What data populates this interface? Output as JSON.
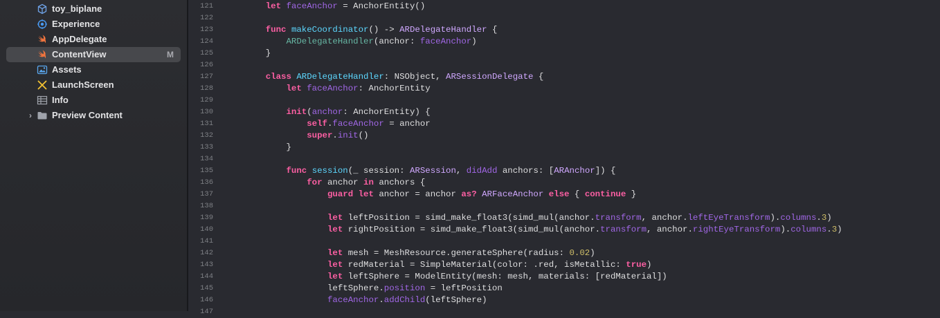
{
  "sidebar": {
    "items": [
      {
        "label": "toy_biplane",
        "icon": "cube-icon",
        "badge": ""
      },
      {
        "label": "Experience",
        "icon": "reality-composer-icon",
        "badge": ""
      },
      {
        "label": "AppDelegate",
        "icon": "swift-icon",
        "badge": ""
      },
      {
        "label": "ContentView",
        "icon": "swift-icon",
        "badge": "M",
        "selected": true
      },
      {
        "label": "Assets",
        "icon": "asset-catalog-icon",
        "badge": ""
      },
      {
        "label": "LaunchScreen",
        "icon": "storyboard-icon",
        "badge": ""
      },
      {
        "label": "Info",
        "icon": "plist-table-icon",
        "badge": ""
      },
      {
        "label": "Preview Content",
        "icon": "folder-icon",
        "badge": "",
        "chevron": "›"
      }
    ]
  },
  "editor": {
    "lines": [
      {
        "n": "121",
        "t": [
          [
            "    ",
            "pl"
          ],
          [
            "let",
            "kw"
          ],
          [
            " ",
            "pl"
          ],
          [
            "faceAnchor",
            "pr"
          ],
          [
            " = ",
            "pl"
          ],
          [
            "AnchorEntity",
            "pl"
          ],
          [
            "()",
            "pl"
          ]
        ]
      },
      {
        "n": "122",
        "t": []
      },
      {
        "n": "123",
        "t": [
          [
            "    ",
            "pl"
          ],
          [
            "func",
            "kw"
          ],
          [
            " ",
            "pl"
          ],
          [
            "makeCoordinator",
            "id"
          ],
          [
            "() -> ",
            "pl"
          ],
          [
            "ARDelegateHandler",
            "ty"
          ],
          [
            " {",
            "pl"
          ]
        ]
      },
      {
        "n": "124",
        "t": [
          [
            "        ",
            "pl"
          ],
          [
            "ARDelegateHandler",
            "fn"
          ],
          [
            "(anchor: ",
            "pl"
          ],
          [
            "faceAnchor",
            "pr"
          ],
          [
            ")",
            "pl"
          ]
        ]
      },
      {
        "n": "125",
        "t": [
          [
            "    }",
            "pl"
          ]
        ]
      },
      {
        "n": "126",
        "t": []
      },
      {
        "n": "127",
        "t": [
          [
            "    ",
            "pl"
          ],
          [
            "class",
            "kw"
          ],
          [
            " ",
            "pl"
          ],
          [
            "ARDelegateHandler",
            "id"
          ],
          [
            ": ",
            "pl"
          ],
          [
            "NSObject",
            "pl"
          ],
          [
            ", ",
            "pl"
          ],
          [
            "ARSessionDelegate",
            "ty"
          ],
          [
            " {",
            "pl"
          ]
        ]
      },
      {
        "n": "128",
        "t": [
          [
            "        ",
            "pl"
          ],
          [
            "let",
            "kw"
          ],
          [
            " ",
            "pl"
          ],
          [
            "faceAnchor",
            "pr"
          ],
          [
            ": ",
            "pl"
          ],
          [
            "AnchorEntity",
            "pl"
          ]
        ]
      },
      {
        "n": "129",
        "t": []
      },
      {
        "n": "130",
        "t": [
          [
            "        ",
            "pl"
          ],
          [
            "init",
            "kw"
          ],
          [
            "(",
            "pl"
          ],
          [
            "anchor",
            "pr"
          ],
          [
            ": ",
            "pl"
          ],
          [
            "AnchorEntity",
            "pl"
          ],
          [
            ") {",
            "pl"
          ]
        ]
      },
      {
        "n": "131",
        "t": [
          [
            "            ",
            "pl"
          ],
          [
            "self",
            "kw"
          ],
          [
            ".",
            "pl"
          ],
          [
            "faceAnchor",
            "pr"
          ],
          [
            " = anchor",
            "pl"
          ]
        ]
      },
      {
        "n": "132",
        "t": [
          [
            "            ",
            "pl"
          ],
          [
            "super",
            "kw"
          ],
          [
            ".",
            "pl"
          ],
          [
            "init",
            "pr"
          ],
          [
            "()",
            "pl"
          ]
        ]
      },
      {
        "n": "133",
        "t": [
          [
            "        }",
            "pl"
          ]
        ]
      },
      {
        "n": "134",
        "t": []
      },
      {
        "n": "135",
        "t": [
          [
            "        ",
            "pl"
          ],
          [
            "func",
            "kw"
          ],
          [
            " ",
            "pl"
          ],
          [
            "session",
            "id"
          ],
          [
            "(_ session: ",
            "pl"
          ],
          [
            "ARSession",
            "ty"
          ],
          [
            ", ",
            "pl"
          ],
          [
            "didAdd",
            "pr"
          ],
          [
            " anchors: [",
            "pl"
          ],
          [
            "ARAnchor",
            "ty"
          ],
          [
            "]) {",
            "pl"
          ]
        ]
      },
      {
        "n": "136",
        "t": [
          [
            "            ",
            "pl"
          ],
          [
            "for",
            "kw"
          ],
          [
            " anchor ",
            "pl"
          ],
          [
            "in",
            "kw"
          ],
          [
            " anchors {",
            "pl"
          ]
        ]
      },
      {
        "n": "137",
        "t": [
          [
            "                ",
            "pl"
          ],
          [
            "guard",
            "kw"
          ],
          [
            " ",
            "pl"
          ],
          [
            "let",
            "kw"
          ],
          [
            " anchor = anchor ",
            "pl"
          ],
          [
            "as?",
            "kw"
          ],
          [
            " ",
            "pl"
          ],
          [
            "ARFaceAnchor",
            "ty"
          ],
          [
            " ",
            "pl"
          ],
          [
            "else",
            "kw"
          ],
          [
            " { ",
            "pl"
          ],
          [
            "continue",
            "kw"
          ],
          [
            " }",
            "pl"
          ]
        ]
      },
      {
        "n": "138",
        "t": []
      },
      {
        "n": "139",
        "t": [
          [
            "                ",
            "pl"
          ],
          [
            "let",
            "kw"
          ],
          [
            " leftPosition = simd_make_float3(simd_mul(anchor.",
            "pl"
          ],
          [
            "transform",
            "pr"
          ],
          [
            ", anchor.",
            "pl"
          ],
          [
            "leftEyeTransform",
            "pr"
          ],
          [
            ").",
            "pl"
          ],
          [
            "columns",
            "pr"
          ],
          [
            ".",
            "pl"
          ],
          [
            "3",
            "num"
          ],
          [
            ")",
            "pl"
          ]
        ]
      },
      {
        "n": "140",
        "t": [
          [
            "                ",
            "pl"
          ],
          [
            "let",
            "kw"
          ],
          [
            " rightPosition = simd_make_float3(simd_mul(anchor.",
            "pl"
          ],
          [
            "transform",
            "pr"
          ],
          [
            ", anchor.",
            "pl"
          ],
          [
            "rightEyeTransform",
            "pr"
          ],
          [
            ").",
            "pl"
          ],
          [
            "columns",
            "pr"
          ],
          [
            ".",
            "pl"
          ],
          [
            "3",
            "num"
          ],
          [
            ")",
            "pl"
          ]
        ]
      },
      {
        "n": "141",
        "t": []
      },
      {
        "n": "142",
        "t": [
          [
            "                ",
            "pl"
          ],
          [
            "let",
            "kw"
          ],
          [
            " mesh = MeshResource.generateSphere(radius: ",
            "pl"
          ],
          [
            "0.02",
            "num"
          ],
          [
            ")",
            "pl"
          ]
        ]
      },
      {
        "n": "143",
        "t": [
          [
            "                ",
            "pl"
          ],
          [
            "let",
            "kw"
          ],
          [
            " redMaterial = SimpleMaterial(color: .red, isMetallic: ",
            "pl"
          ],
          [
            "true",
            "kw"
          ],
          [
            ")",
            "pl"
          ]
        ]
      },
      {
        "n": "144",
        "t": [
          [
            "                ",
            "pl"
          ],
          [
            "let",
            "kw"
          ],
          [
            " leftSphere = ModelEntity(mesh: mesh, materials: [redMaterial])",
            "pl"
          ]
        ]
      },
      {
        "n": "145",
        "t": [
          [
            "                leftSphere.",
            "pl"
          ],
          [
            "position",
            "pr"
          ],
          [
            " = leftPosition",
            "pl"
          ]
        ]
      },
      {
        "n": "146",
        "t": [
          [
            "                ",
            "pl"
          ],
          [
            "faceAnchor",
            "pr"
          ],
          [
            ".",
            "pl"
          ],
          [
            "addChild",
            "pr"
          ],
          [
            "(leftSphere)",
            "pl"
          ]
        ]
      },
      {
        "n": "147",
        "t": []
      }
    ]
  },
  "colors": {
    "background": "#292a30",
    "sidebar": "#2c2d31",
    "keyword": "#fc5fa3",
    "type": "#d0a8ff",
    "property": "#a167e6",
    "declaration": "#5dd8ff",
    "number": "#d0bf69",
    "plain": "#dfdfe0",
    "line_number": "#7e8085"
  }
}
